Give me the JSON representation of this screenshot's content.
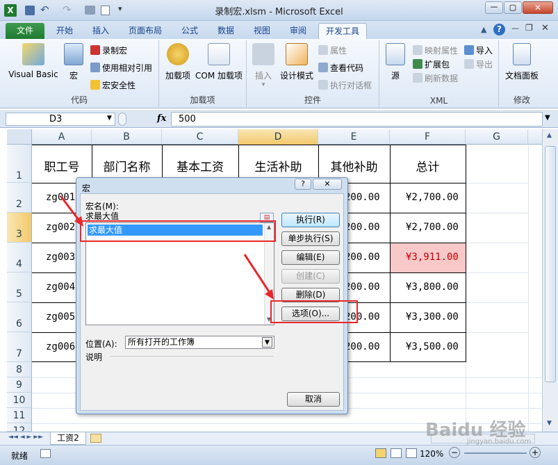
{
  "window": {
    "title": "录制宏.xlsm - Microsoft Excel"
  },
  "tabs": [
    "文件",
    "开始",
    "插入",
    "页面布局",
    "公式",
    "数据",
    "视图",
    "审阅",
    "开发工具"
  ],
  "ribbon": {
    "code": {
      "label": "代码",
      "visual_basic": "Visual Basic",
      "macros": "宏",
      "record": "录制宏",
      "relative": "使用相对引用",
      "security": "宏安全性"
    },
    "addins": {
      "label": "加载项",
      "addins": "加载项",
      "com": "COM 加载项"
    },
    "controls": {
      "label": "控件",
      "insert": "插入",
      "design": "设计模式",
      "properties": "属性",
      "view_code": "查看代码",
      "run_dialog": "执行对话框"
    },
    "xml": {
      "label": "XML",
      "source": "源",
      "map_props": "映射属性",
      "expansion": "扩展包",
      "refresh": "刷新数据",
      "import": "导入",
      "export": "导出"
    },
    "modify": {
      "label": "修改",
      "doc_panel": "文档面板"
    }
  },
  "formula": {
    "name_box": "D3",
    "fx": "fx",
    "value": "500"
  },
  "columns": [
    "A",
    "B",
    "C",
    "D",
    "E",
    "F",
    "G"
  ],
  "rows": [
    "1",
    "2",
    "3",
    "4",
    "5",
    "6",
    "7",
    "8",
    "9",
    "10",
    "11",
    "12"
  ],
  "table": {
    "headers": [
      "职工号",
      "部门名称",
      "基本工资",
      "生活补助",
      "其他补助",
      "总计"
    ],
    "ids": [
      "zg001",
      "zg002",
      "zg003",
      "zg004",
      "zg005",
      "zg006"
    ],
    "other": [
      "200.00",
      "200.00",
      "200.00",
      "200.00",
      "200.00",
      "200.00"
    ],
    "totals": [
      "¥2,700.00",
      "¥2,700.00",
      "¥3,911.00",
      "¥3,800.00",
      "¥3,300.00",
      "¥3,500.00"
    ]
  },
  "dialog": {
    "title": "宏",
    "help": "?",
    "close": "✕",
    "name_label": "宏名(M):",
    "name_value": "求最大值",
    "list_item": "求最大值",
    "run": "执行(R)",
    "step": "单步执行(S)",
    "edit": "编辑(E)",
    "create": "创建(C)",
    "delete": "删除(D)",
    "options": "选项(O)...",
    "location_label": "位置(A):",
    "location_value": "所有打开的工作簿",
    "desc_label": "说明",
    "cancel": "取消"
  },
  "sheet": {
    "tab": "工资2"
  },
  "status": {
    "ready": "就绪",
    "zoom": "120%"
  },
  "watermark": {
    "text": "Baidu 经验",
    "sub": "jingyan.baidu.com"
  },
  "colors": {
    "highlight": "#f9c9ca",
    "highlight_text": "#c00000",
    "accent": "#1e7a30",
    "red_box": "#e8262b",
    "selection": "#3399ff"
  }
}
